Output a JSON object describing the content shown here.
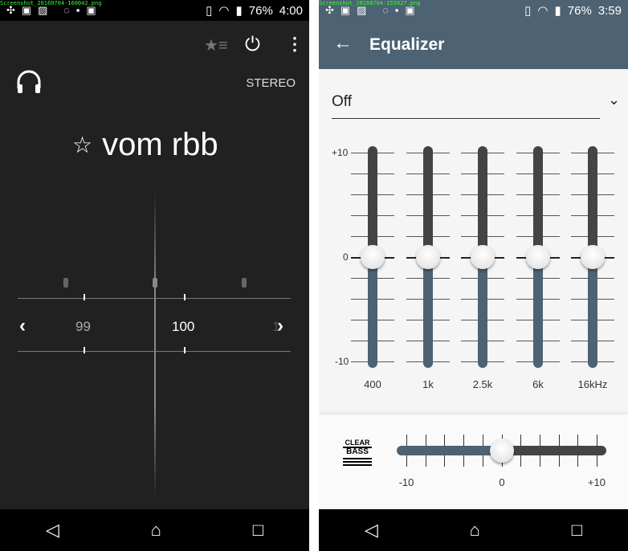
{
  "left": {
    "status": {
      "filename": "Screenshot_20160704-160042.png",
      "battery": "76%",
      "time": "4:00"
    },
    "mode": "STEREO",
    "station": "vom rbb",
    "freq_labels": [
      "99",
      "100",
      "1"
    ],
    "icons": [
      "favorites-list-icon",
      "power-icon",
      "more-icon",
      "headphones-icon",
      "star-icon",
      "chevron-left-icon",
      "chevron-right-icon"
    ]
  },
  "right": {
    "status": {
      "filename": "Screenshot_20160704-155927.png",
      "battery": "76%",
      "time": "3:59"
    },
    "title": "Equalizer",
    "preset": "Off",
    "scale": {
      "top": "+10",
      "mid": "0",
      "bottom": "-10"
    },
    "bands": [
      {
        "label": "400",
        "value": 0
      },
      {
        "label": "1k",
        "value": 0
      },
      {
        "label": "2.5k",
        "value": 0
      },
      {
        "label": "6k",
        "value": 0
      },
      {
        "label": "16kHz",
        "value": 0
      }
    ],
    "clear_bass": {
      "logo_top": "CLEAR",
      "logo_bottom": "BASS",
      "min": "-10",
      "mid": "0",
      "max": "+10",
      "value": 0
    },
    "colors": {
      "accent": "#4d6273",
      "track_off": "#444444"
    }
  }
}
